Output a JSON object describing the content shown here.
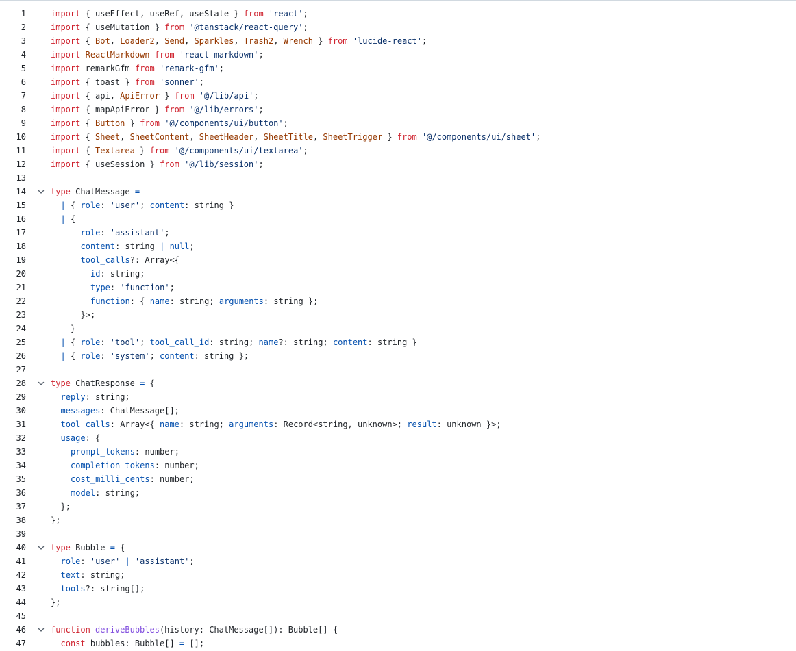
{
  "lines": [
    {
      "n": "1",
      "fold": false,
      "indent": 0,
      "t": [
        [
          "k",
          "import"
        ],
        [
          "",
          "{ useEffect, useRef, useState } "
        ],
        [
          "k",
          "from"
        ],
        [
          "",
          " "
        ],
        [
          "s",
          "'react'"
        ],
        [
          "",
          ";"
        ]
      ]
    },
    {
      "n": "2",
      "fold": false,
      "indent": 0,
      "t": [
        [
          "k",
          "import"
        ],
        [
          "",
          "{ useMutation } "
        ],
        [
          "k",
          "from"
        ],
        [
          "",
          " "
        ],
        [
          "s",
          "'@tanstack/react-query'"
        ],
        [
          "",
          ";"
        ]
      ]
    },
    {
      "n": "3",
      "fold": false,
      "indent": 0,
      "t": [
        [
          "k",
          "import"
        ],
        [
          "",
          "{ "
        ],
        [
          "c",
          "Bot"
        ],
        [
          "",
          ", "
        ],
        [
          "c",
          "Loader2"
        ],
        [
          "",
          ", "
        ],
        [
          "c",
          "Send"
        ],
        [
          "",
          ", "
        ],
        [
          "c",
          "Sparkles"
        ],
        [
          "",
          ", "
        ],
        [
          "c",
          "Trash2"
        ],
        [
          "",
          ", "
        ],
        [
          "c",
          "Wrench"
        ],
        [
          "",
          " } "
        ],
        [
          "k",
          "from"
        ],
        [
          "",
          " "
        ],
        [
          "s",
          "'lucide-react'"
        ],
        [
          "",
          ";"
        ]
      ]
    },
    {
      "n": "4",
      "fold": false,
      "indent": 0,
      "t": [
        [
          "k",
          "import"
        ],
        [
          "",
          " "
        ],
        [
          "c",
          "ReactMarkdown"
        ],
        [
          "",
          " "
        ],
        [
          "k",
          "from"
        ],
        [
          "",
          " "
        ],
        [
          "s",
          "'react-markdown'"
        ],
        [
          "",
          ";"
        ]
      ]
    },
    {
      "n": "5",
      "fold": false,
      "indent": 0,
      "t": [
        [
          "k",
          "import"
        ],
        [
          "",
          " remarkGfm "
        ],
        [
          "k",
          "from"
        ],
        [
          "",
          " "
        ],
        [
          "s",
          "'remark-gfm'"
        ],
        [
          "",
          ";"
        ]
      ]
    },
    {
      "n": "6",
      "fold": false,
      "indent": 0,
      "t": [
        [
          "k",
          "import"
        ],
        [
          "",
          "{ toast } "
        ],
        [
          "k",
          "from"
        ],
        [
          "",
          " "
        ],
        [
          "s",
          "'sonner'"
        ],
        [
          "",
          ";"
        ]
      ]
    },
    {
      "n": "7",
      "fold": false,
      "indent": 0,
      "t": [
        [
          "k",
          "import"
        ],
        [
          "",
          "{ api, "
        ],
        [
          "c",
          "ApiError"
        ],
        [
          "",
          " } "
        ],
        [
          "k",
          "from"
        ],
        [
          "",
          " "
        ],
        [
          "s",
          "'@/lib/api'"
        ],
        [
          "",
          ";"
        ]
      ]
    },
    {
      "n": "8",
      "fold": false,
      "indent": 0,
      "t": [
        [
          "k",
          "import"
        ],
        [
          "",
          "{ mapApiError } "
        ],
        [
          "k",
          "from"
        ],
        [
          "",
          " "
        ],
        [
          "s",
          "'@/lib/errors'"
        ],
        [
          "",
          ";"
        ]
      ]
    },
    {
      "n": "9",
      "fold": false,
      "indent": 0,
      "t": [
        [
          "k",
          "import"
        ],
        [
          "",
          "{ "
        ],
        [
          "c",
          "Button"
        ],
        [
          "",
          " } "
        ],
        [
          "k",
          "from"
        ],
        [
          "",
          " "
        ],
        [
          "s",
          "'@/components/ui/button'"
        ],
        [
          "",
          ";"
        ]
      ]
    },
    {
      "n": "10",
      "fold": false,
      "indent": 0,
      "t": [
        [
          "k",
          "import"
        ],
        [
          "",
          "{ "
        ],
        [
          "c",
          "Sheet"
        ],
        [
          "",
          ", "
        ],
        [
          "c",
          "SheetContent"
        ],
        [
          "",
          ", "
        ],
        [
          "c",
          "SheetHeader"
        ],
        [
          "",
          ", "
        ],
        [
          "c",
          "SheetTitle"
        ],
        [
          "",
          ", "
        ],
        [
          "c",
          "SheetTrigger"
        ],
        [
          "",
          " } "
        ],
        [
          "k",
          "from"
        ],
        [
          "",
          " "
        ],
        [
          "s",
          "'@/components/ui/sheet'"
        ],
        [
          "",
          ";"
        ]
      ]
    },
    {
      "n": "11",
      "fold": false,
      "indent": 0,
      "t": [
        [
          "k",
          "import"
        ],
        [
          "",
          "{ "
        ],
        [
          "c",
          "Textarea"
        ],
        [
          "",
          " } "
        ],
        [
          "k",
          "from"
        ],
        [
          "",
          " "
        ],
        [
          "s",
          "'@/components/ui/textarea'"
        ],
        [
          "",
          ";"
        ]
      ]
    },
    {
      "n": "12",
      "fold": false,
      "indent": 0,
      "t": [
        [
          "k",
          "import"
        ],
        [
          "",
          "{ useSession } "
        ],
        [
          "k",
          "from"
        ],
        [
          "",
          " "
        ],
        [
          "s",
          "'@/lib/session'"
        ],
        [
          "",
          ";"
        ]
      ]
    },
    {
      "n": "13",
      "fold": false,
      "indent": 0,
      "t": []
    },
    {
      "n": "14",
      "fold": true,
      "indent": 0,
      "t": [
        [
          "k",
          "type"
        ],
        [
          "",
          " ChatMessage "
        ],
        [
          "p",
          "="
        ]
      ]
    },
    {
      "n": "15",
      "fold": false,
      "indent": 1,
      "t": [
        [
          "p",
          "|"
        ],
        [
          "",
          " { "
        ],
        [
          "p",
          "role"
        ],
        [
          "",
          ": "
        ],
        [
          "s",
          "'user'"
        ],
        [
          "",
          "; "
        ],
        [
          "p",
          "content"
        ],
        [
          "",
          ": string }"
        ]
      ]
    },
    {
      "n": "16",
      "fold": false,
      "indent": 1,
      "t": [
        [
          "p",
          "|"
        ],
        [
          "",
          " {"
        ]
      ]
    },
    {
      "n": "17",
      "fold": false,
      "indent": 3,
      "t": [
        [
          "p",
          "role"
        ],
        [
          "",
          ": "
        ],
        [
          "s",
          "'assistant'"
        ],
        [
          "",
          ";"
        ]
      ]
    },
    {
      "n": "18",
      "fold": false,
      "indent": 3,
      "t": [
        [
          "p",
          "content"
        ],
        [
          "",
          ": string "
        ],
        [
          "p",
          "|"
        ],
        [
          "",
          " "
        ],
        [
          "p",
          "null"
        ],
        [
          "",
          ";"
        ]
      ]
    },
    {
      "n": "19",
      "fold": false,
      "indent": 3,
      "t": [
        [
          "p",
          "tool_calls"
        ],
        [
          "",
          "?: Array<{"
        ]
      ]
    },
    {
      "n": "20",
      "fold": false,
      "indent": 4,
      "t": [
        [
          "p",
          "id"
        ],
        [
          "",
          ": string;"
        ]
      ]
    },
    {
      "n": "21",
      "fold": false,
      "indent": 4,
      "t": [
        [
          "p",
          "type"
        ],
        [
          "",
          ": "
        ],
        [
          "s",
          "'function'"
        ],
        [
          "",
          ";"
        ]
      ]
    },
    {
      "n": "22",
      "fold": false,
      "indent": 4,
      "t": [
        [
          "p",
          "function"
        ],
        [
          "",
          ": { "
        ],
        [
          "p",
          "name"
        ],
        [
          "",
          ": string; "
        ],
        [
          "p",
          "arguments"
        ],
        [
          "",
          ": string };"
        ]
      ]
    },
    {
      "n": "23",
      "fold": false,
      "indent": 3,
      "t": [
        [
          "",
          "}>;"
        ]
      ]
    },
    {
      "n": "24",
      "fold": false,
      "indent": 2,
      "t": [
        [
          "",
          "}"
        ]
      ]
    },
    {
      "n": "25",
      "fold": false,
      "indent": 1,
      "t": [
        [
          "p",
          "|"
        ],
        [
          "",
          " { "
        ],
        [
          "p",
          "role"
        ],
        [
          "",
          ": "
        ],
        [
          "s",
          "'tool'"
        ],
        [
          "",
          "; "
        ],
        [
          "p",
          "tool_call_id"
        ],
        [
          "",
          ": string; "
        ],
        [
          "p",
          "name"
        ],
        [
          "",
          "?: string; "
        ],
        [
          "p",
          "content"
        ],
        [
          "",
          ": string }"
        ]
      ]
    },
    {
      "n": "26",
      "fold": false,
      "indent": 1,
      "t": [
        [
          "p",
          "|"
        ],
        [
          "",
          " { "
        ],
        [
          "p",
          "role"
        ],
        [
          "",
          ": "
        ],
        [
          "s",
          "'system'"
        ],
        [
          "",
          "; "
        ],
        [
          "p",
          "content"
        ],
        [
          "",
          ": string };"
        ]
      ]
    },
    {
      "n": "27",
      "fold": false,
      "indent": 0,
      "t": []
    },
    {
      "n": "28",
      "fold": true,
      "indent": 0,
      "t": [
        [
          "k",
          "type"
        ],
        [
          "",
          " ChatResponse "
        ],
        [
          "p",
          "="
        ],
        [
          "",
          " {"
        ]
      ]
    },
    {
      "n": "29",
      "fold": false,
      "indent": 1,
      "t": [
        [
          "p",
          "reply"
        ],
        [
          "",
          ": string;"
        ]
      ]
    },
    {
      "n": "30",
      "fold": false,
      "indent": 1,
      "t": [
        [
          "p",
          "messages"
        ],
        [
          "",
          ": ChatMessage[];"
        ]
      ]
    },
    {
      "n": "31",
      "fold": false,
      "indent": 1,
      "t": [
        [
          "p",
          "tool_calls"
        ],
        [
          "",
          ": Array<{ "
        ],
        [
          "p",
          "name"
        ],
        [
          "",
          ": string; "
        ],
        [
          "p",
          "arguments"
        ],
        [
          "",
          ": Record<string, unknown>; "
        ],
        [
          "p",
          "result"
        ],
        [
          "",
          ": unknown }>;"
        ]
      ]
    },
    {
      "n": "32",
      "fold": false,
      "indent": 1,
      "t": [
        [
          "p",
          "usage"
        ],
        [
          "",
          ": {"
        ]
      ]
    },
    {
      "n": "33",
      "fold": false,
      "indent": 2,
      "t": [
        [
          "p",
          "prompt_tokens"
        ],
        [
          "",
          ": number;"
        ]
      ]
    },
    {
      "n": "34",
      "fold": false,
      "indent": 2,
      "t": [
        [
          "p",
          "completion_tokens"
        ],
        [
          "",
          ": number;"
        ]
      ]
    },
    {
      "n": "35",
      "fold": false,
      "indent": 2,
      "t": [
        [
          "p",
          "cost_milli_cents"
        ],
        [
          "",
          ": number;"
        ]
      ]
    },
    {
      "n": "36",
      "fold": false,
      "indent": 2,
      "t": [
        [
          "p",
          "model"
        ],
        [
          "",
          ": string;"
        ]
      ]
    },
    {
      "n": "37",
      "fold": false,
      "indent": 1,
      "t": [
        [
          "",
          "};"
        ]
      ]
    },
    {
      "n": "38",
      "fold": false,
      "indent": 0,
      "t": [
        [
          "",
          "};"
        ]
      ]
    },
    {
      "n": "39",
      "fold": false,
      "indent": 0,
      "t": []
    },
    {
      "n": "40",
      "fold": true,
      "indent": 0,
      "t": [
        [
          "k",
          "type"
        ],
        [
          "",
          " Bubble "
        ],
        [
          "p",
          "="
        ],
        [
          "",
          " {"
        ]
      ]
    },
    {
      "n": "41",
      "fold": false,
      "indent": 1,
      "t": [
        [
          "p",
          "role"
        ],
        [
          "",
          ": "
        ],
        [
          "s",
          "'user'"
        ],
        [
          "",
          " "
        ],
        [
          "p",
          "|"
        ],
        [
          "",
          " "
        ],
        [
          "s",
          "'assistant'"
        ],
        [
          "",
          ";"
        ]
      ]
    },
    {
      "n": "42",
      "fold": false,
      "indent": 1,
      "t": [
        [
          "p",
          "text"
        ],
        [
          "",
          ": string;"
        ]
      ]
    },
    {
      "n": "43",
      "fold": false,
      "indent": 1,
      "t": [
        [
          "p",
          "tools"
        ],
        [
          "",
          "?: string[];"
        ]
      ]
    },
    {
      "n": "44",
      "fold": false,
      "indent": 0,
      "t": [
        [
          "",
          "};"
        ]
      ]
    },
    {
      "n": "45",
      "fold": false,
      "indent": 0,
      "t": []
    },
    {
      "n": "46",
      "fold": true,
      "indent": 0,
      "t": [
        [
          "k",
          "function"
        ],
        [
          "",
          " "
        ],
        [
          "f",
          "deriveBubbles"
        ],
        [
          "",
          "(history: ChatMessage[]): Bubble[] {"
        ]
      ]
    },
    {
      "n": "47",
      "fold": false,
      "indent": 1,
      "t": [
        [
          "k",
          "const"
        ],
        [
          "",
          " bubbles: Bubble[] "
        ],
        [
          "p",
          "="
        ],
        [
          "",
          " [];"
        ]
      ]
    }
  ]
}
